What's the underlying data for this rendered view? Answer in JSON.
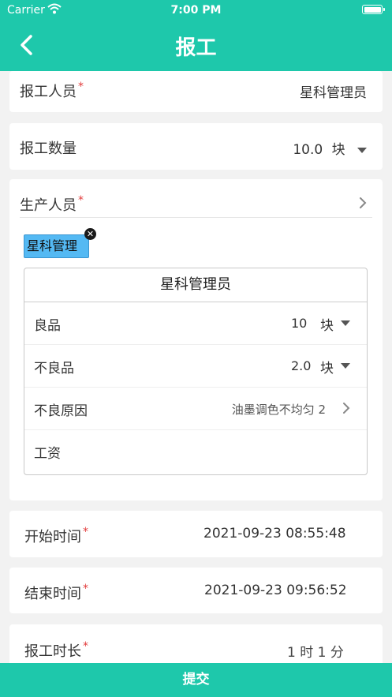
{
  "status_bar": {
    "carrier": "Carrier",
    "time": "7:00 PM"
  },
  "nav": {
    "title": "报工"
  },
  "reporter": {
    "label": "报工人员",
    "required": "*",
    "value": "星科管理员"
  },
  "quantity": {
    "label": "报工数量",
    "value": "10.0",
    "unit": "块"
  },
  "producers": {
    "label": "生产人员",
    "required": "*",
    "tag": "星科管理",
    "detail": {
      "title": "星科管理员",
      "good": {
        "label": "良品",
        "value": "10",
        "unit": "块"
      },
      "defective": {
        "label": "不良品",
        "value": "2.0",
        "unit": "块"
      },
      "defect_reason": {
        "label": "不良原因",
        "value": "油墨调色不均匀 2"
      },
      "wage": {
        "label": "工资",
        "value": ""
      }
    }
  },
  "start_time": {
    "label": "开始时间",
    "required": "*",
    "value": "2021-09-23 08:55:48"
  },
  "end_time": {
    "label": "结束时间",
    "required": "*",
    "value": "2021-09-23 09:56:52"
  },
  "duration": {
    "label": "报工时长",
    "required": "*",
    "value": "1 时 1 分"
  },
  "submit": {
    "label": "提交"
  }
}
